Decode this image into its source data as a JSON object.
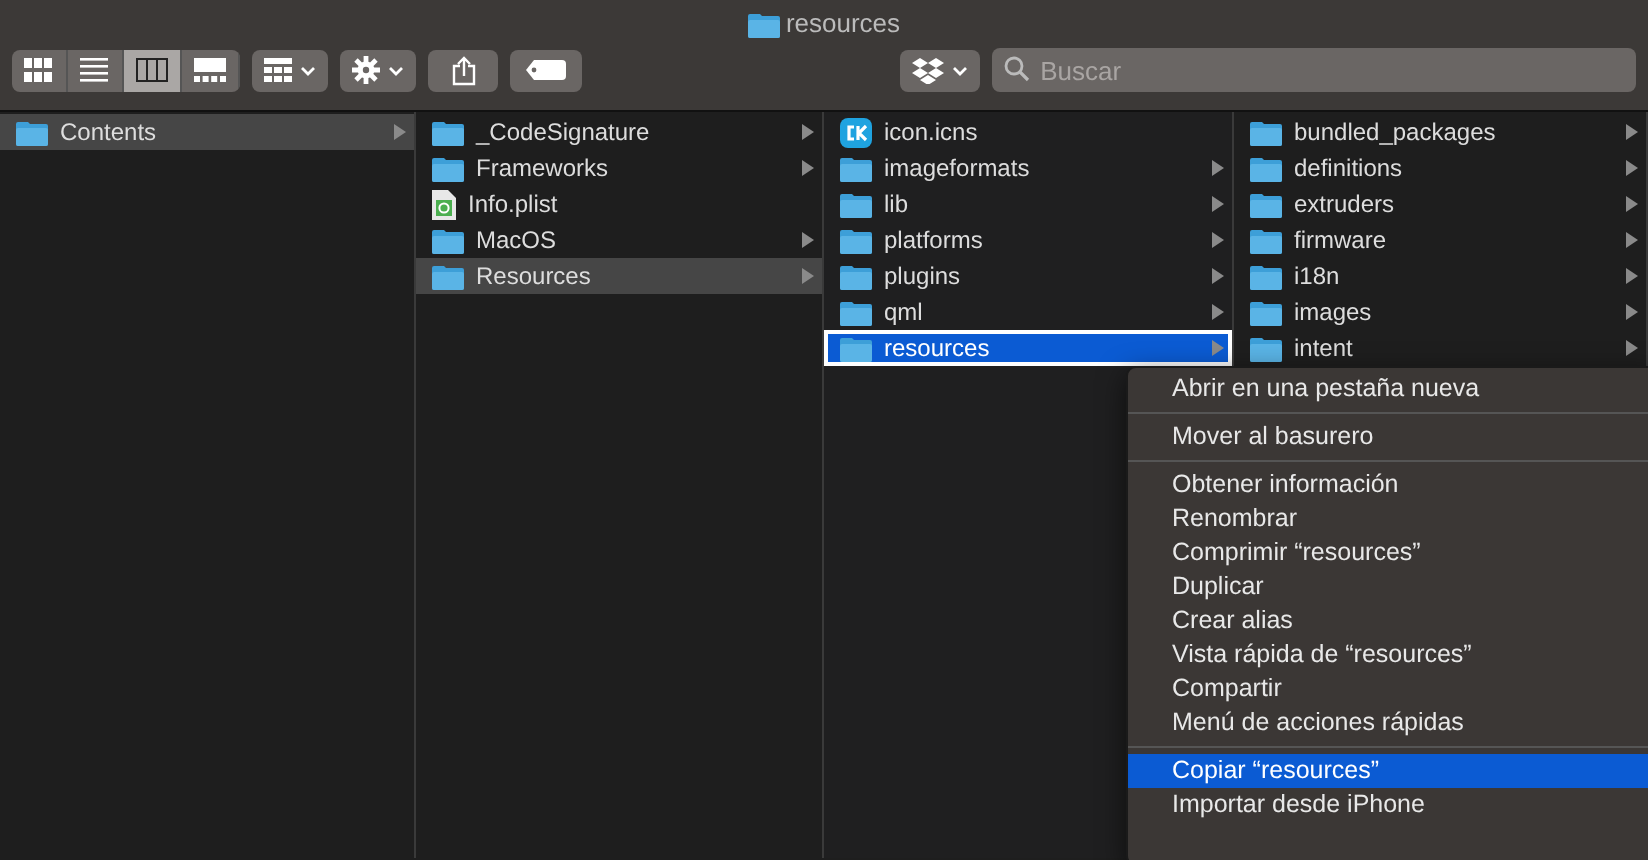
{
  "window": {
    "title": "resources"
  },
  "toolbar": {
    "view_modes": [
      {
        "kind": "icons",
        "selected": false
      },
      {
        "kind": "list",
        "selected": false
      },
      {
        "kind": "columns",
        "selected": true
      },
      {
        "kind": "gallery",
        "selected": false
      }
    ],
    "search": {
      "placeholder": "Buscar"
    }
  },
  "columns": [
    {
      "focused": false,
      "items": [
        {
          "name": "Contents",
          "kind": "folder",
          "has_children": true,
          "selected": true
        }
      ]
    },
    {
      "focused": false,
      "items": [
        {
          "name": "_CodeSignature",
          "kind": "folder",
          "has_children": true,
          "selected": false
        },
        {
          "name": "Frameworks",
          "kind": "folder",
          "has_children": true,
          "selected": false
        },
        {
          "name": "Info.plist",
          "kind": "plist",
          "has_children": false,
          "selected": false
        },
        {
          "name": "MacOS",
          "kind": "folder",
          "has_children": true,
          "selected": false
        },
        {
          "name": "Resources",
          "kind": "folder",
          "has_children": true,
          "selected": true
        }
      ]
    },
    {
      "focused": true,
      "items": [
        {
          "name": "icon.icns",
          "kind": "icns",
          "has_children": false,
          "selected": false
        },
        {
          "name": "imageformats",
          "kind": "folder",
          "has_children": true,
          "selected": false
        },
        {
          "name": "lib",
          "kind": "folder",
          "has_children": true,
          "selected": false
        },
        {
          "name": "platforms",
          "kind": "folder",
          "has_children": true,
          "selected": false
        },
        {
          "name": "plugins",
          "kind": "folder",
          "has_children": true,
          "selected": false
        },
        {
          "name": "qml",
          "kind": "folder",
          "has_children": true,
          "selected": false
        },
        {
          "name": "resources",
          "kind": "folder",
          "has_children": true,
          "selected": true
        }
      ]
    },
    {
      "focused": false,
      "items": [
        {
          "name": "bundled_packages",
          "kind": "folder",
          "has_children": true,
          "selected": false
        },
        {
          "name": "definitions",
          "kind": "folder",
          "has_children": true,
          "selected": false
        },
        {
          "name": "extruders",
          "kind": "folder",
          "has_children": true,
          "selected": false
        },
        {
          "name": "firmware",
          "kind": "folder",
          "has_children": true,
          "selected": false
        },
        {
          "name": "i18n",
          "kind": "folder",
          "has_children": true,
          "selected": false
        },
        {
          "name": "images",
          "kind": "folder",
          "has_children": true,
          "selected": false
        },
        {
          "name": "intent",
          "kind": "folder",
          "has_children": true,
          "selected": false
        }
      ]
    }
  ],
  "context_menu": {
    "items": [
      {
        "kind": "item",
        "label": "Abrir en una pestaña nueva",
        "selected": false
      },
      {
        "kind": "separator"
      },
      {
        "kind": "item",
        "label": "Mover al basurero",
        "selected": false
      },
      {
        "kind": "separator"
      },
      {
        "kind": "item",
        "label": "Obtener información",
        "selected": false
      },
      {
        "kind": "item",
        "label": "Renombrar",
        "selected": false
      },
      {
        "kind": "item",
        "label": "Comprimir “resources”",
        "selected": false
      },
      {
        "kind": "item",
        "label": "Duplicar",
        "selected": false
      },
      {
        "kind": "item",
        "label": "Crear alias",
        "selected": false
      },
      {
        "kind": "item",
        "label": "Vista rápida de “resources”",
        "selected": false
      },
      {
        "kind": "item",
        "label": "Compartir",
        "selected": false
      },
      {
        "kind": "item",
        "label": "Menú de acciones rápidas",
        "selected": false
      },
      {
        "kind": "separator"
      },
      {
        "kind": "item",
        "label": "Copiar “resources”",
        "selected": true
      },
      {
        "kind": "item",
        "label": "Importar desde iPhone",
        "selected": false
      }
    ]
  }
}
